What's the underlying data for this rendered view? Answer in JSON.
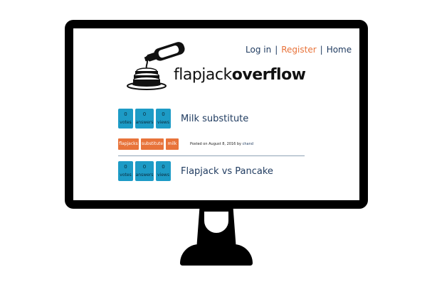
{
  "nav": {
    "login": "Log in",
    "register": "Register",
    "home": "Home",
    "separator": "|"
  },
  "brand": {
    "light": "flapjack",
    "bold": "overflow"
  },
  "colors": {
    "stat_bg": "#1d9bc6",
    "tag_bg": "#e8733a",
    "link": "#1e3a5f",
    "register": "#e8733a"
  },
  "questions": [
    {
      "title": "Milk substitute",
      "votes": "0",
      "votes_label": "votes",
      "answers": "0",
      "answers_label": "answers",
      "views": "0",
      "views_label": "views",
      "tags": [
        "flapjacks",
        "substitute",
        "milk"
      ],
      "posted_prefix": "Posted on August 8, 2016 by",
      "author": "chand"
    },
    {
      "title": "Flapjack vs Pancake",
      "votes": "0",
      "votes_label": "votes",
      "answers": "0",
      "answers_label": "answers",
      "views": "0",
      "views_label": "views"
    }
  ]
}
